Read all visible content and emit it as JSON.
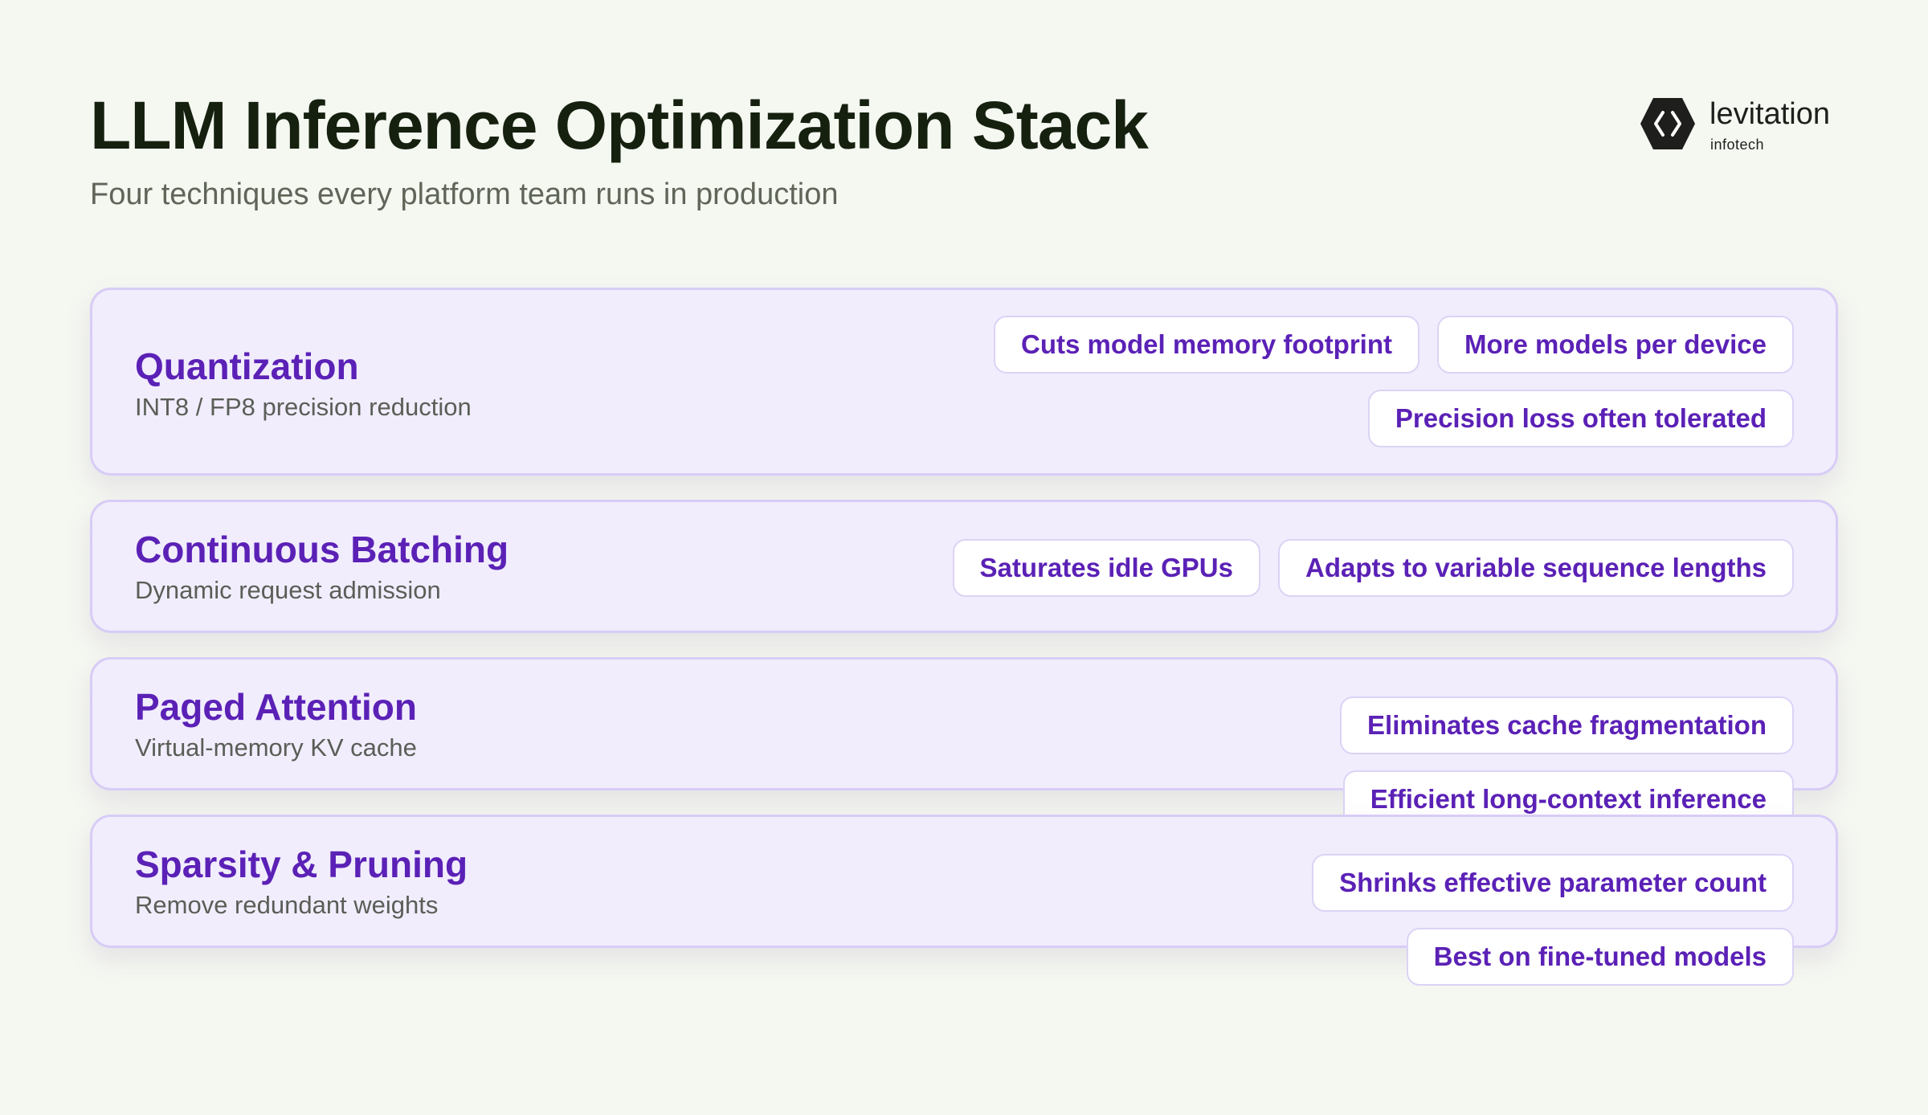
{
  "header": {
    "title": "LLM Inference Optimization Stack",
    "subtitle": "Four techniques every platform team runs in production"
  },
  "brand": {
    "name": "levitation",
    "sub": "infotech",
    "logo_icon": "hexagon-code-icon"
  },
  "colors": {
    "background": "#f5f7f1",
    "card_background": "#f1edfd",
    "card_border": "#d8ccf6",
    "accent": "#5b21b6",
    "title": "#15200f"
  },
  "layers": [
    {
      "name": "Quantization",
      "desc": "INT8 / FP8 precision reduction",
      "chips": [
        "Cuts model memory footprint",
        "More models per device",
        "Precision loss often tolerated"
      ]
    },
    {
      "name": "Continuous Batching",
      "desc": "Dynamic request admission",
      "chips": [
        "Saturates idle GPUs",
        "Adapts to variable sequence lengths"
      ]
    },
    {
      "name": "Paged Attention",
      "desc": "Virtual-memory KV cache",
      "chips": [
        "Eliminates cache fragmentation",
        "Efficient long-context inference"
      ]
    },
    {
      "name": "Sparsity & Pruning",
      "desc": "Remove redundant weights",
      "chips": [
        "Shrinks effective parameter count",
        "Best on fine-tuned models"
      ]
    }
  ]
}
